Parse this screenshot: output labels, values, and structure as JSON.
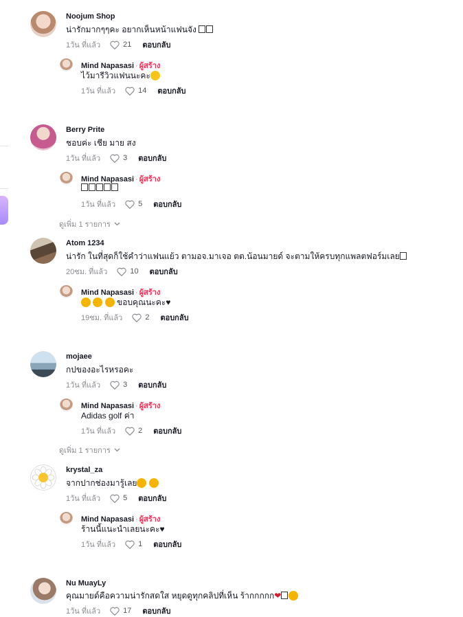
{
  "reply_label": "ตอบกลับ",
  "creator_label": "ผู้สร้าง",
  "comments": [
    {
      "author": "Noojum Shop",
      "text": "น่ารักมากๆๆคะ อยากเห็นหน้าแฟนจัง",
      "time": "1วัน ที่แล้ว",
      "likes": "21",
      "reply": {
        "author": "Mind Napasasi",
        "text": "ไว้มารีวิวแฟนนะคะ",
        "time": "1วัน ที่แล้ว",
        "likes": "14"
      }
    },
    {
      "author": "Berry Prite",
      "text": "ชอบค่ะ เชีย มาย สง",
      "time": "1วัน ที่แล้ว",
      "likes": "3",
      "reply": {
        "author": "Mind Napasasi",
        "text": "",
        "time": "1วัน ที่แล้ว",
        "likes": "5"
      },
      "more": "ดูเพิ่ม 1 รายการ"
    },
    {
      "author": "Atom 1234",
      "text": "น่ารัก ในที่สุดก็ใช้คำว่าแฟนแย้ว ตามอจ.มาเจอ ตต.น้อนมายด์ จะตามให้ครบทุกแพลตฟอร์มเลย",
      "time": "20ชม. ที่แล้ว",
      "likes": "10",
      "reply": {
        "author": "Mind Napasasi",
        "text": "ขอบคุณนะคะ♥",
        "time": "19ชม. ที่แล้ว",
        "likes": "2"
      }
    },
    {
      "author": "mojaee",
      "text": "กปของอะไรหรอคะ",
      "time": "1วัน ที่แล้ว",
      "likes": "3",
      "reply": {
        "author": "Mind Napasasi",
        "text": "Adidas golf ค่า",
        "time": "1วัน ที่แล้ว",
        "likes": "2"
      },
      "more": "ดูเพิ่ม 1 รายการ"
    },
    {
      "author": "krystal_za",
      "text": "จากปากช่องมารู้เลย",
      "time": "1วัน ที่แล้ว",
      "likes": "5",
      "reply": {
        "author": "Mind Napasasi",
        "text": "ร้านนี้แนะนำเลยนะคะ♥",
        "time": "1วัน ที่แล้ว",
        "likes": "1"
      }
    },
    {
      "author": "Nu MuayLy",
      "text": "คุณมายด์คือความน่ารักสดใส หยุดดูทุกคลิปที่เห็น ร้ากกกกก",
      "time": "1วัน ที่แล้ว",
      "likes": "17"
    }
  ],
  "colors": {
    "creator": "#fe2c55",
    "muted": "#8a8b91",
    "text": "#161823"
  }
}
